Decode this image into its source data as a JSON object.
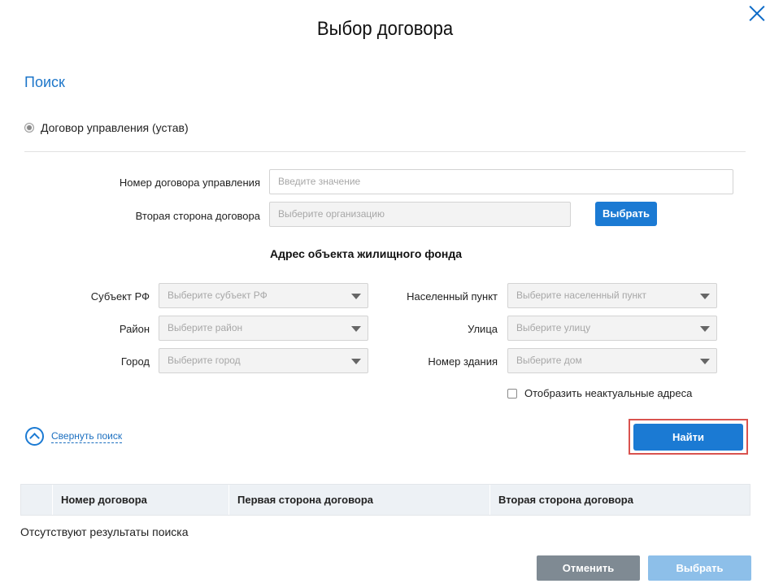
{
  "dialog": {
    "title": "Выбор договора",
    "close_icon": "close-icon"
  },
  "search": {
    "section_title": "Поиск",
    "radio_label": "Договор управления (устав)",
    "contract_number_label": "Номер договора управления",
    "contract_number_placeholder": "Введите значение",
    "second_party_label": "Вторая сторона договора",
    "second_party_placeholder": "Выберите организацию",
    "select_org_button": "Выбрать",
    "address_heading": "Адрес объекта жилищного фонда",
    "region_label": "Субъект РФ",
    "region_placeholder": "Выберите субъект РФ",
    "district_label": "Район",
    "district_placeholder": "Выберите район",
    "city_label": "Город",
    "city_placeholder": "Выберите город",
    "settlement_label": "Населенный пункт",
    "settlement_placeholder": "Выберите населенный пункт",
    "street_label": "Улица",
    "street_placeholder": "Выберите улицу",
    "building_label": "Номер здания",
    "building_placeholder": "Выберите дом",
    "show_inactive_label": "Отобразить неактуальные адреса",
    "collapse_label": "Свернуть поиск",
    "find_button": "Найти"
  },
  "table": {
    "columns": [
      "",
      "Номер договора",
      "Первая сторона договора",
      "Вторая сторона договора"
    ],
    "empty_message": "Отсутствуют результаты поиска"
  },
  "footer": {
    "cancel_button": "Отменить",
    "select_button": "Выбрать"
  },
  "colors": {
    "accent": "#1b7ad3",
    "highlight_outline": "#d9534f",
    "cancel_bg": "#7f8a93",
    "disabled_select_bg": "#8dbfe9"
  }
}
